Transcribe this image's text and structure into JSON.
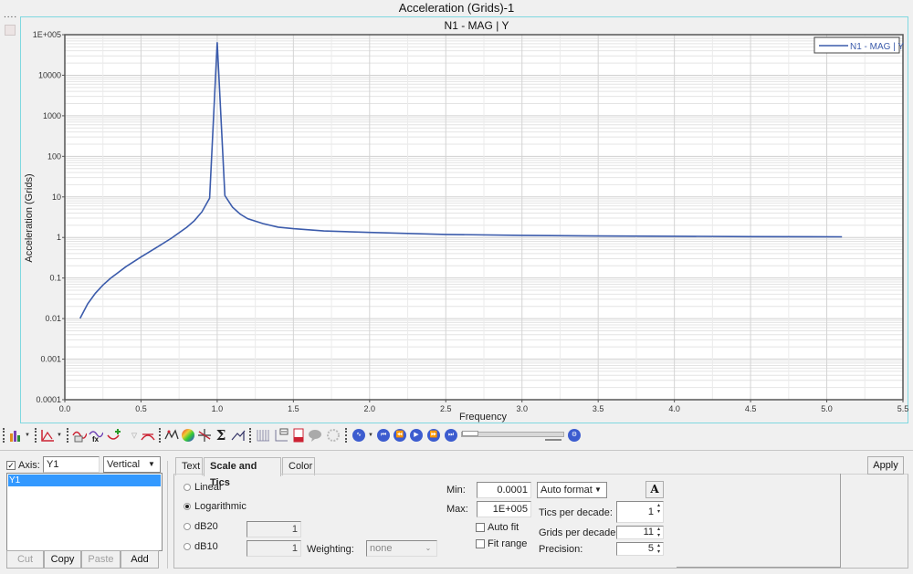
{
  "window": {
    "title": "Acceleration (Grids)-1"
  },
  "chart_data": {
    "type": "line",
    "title": "N1 - MAG | Y",
    "xlabel": "Frequency",
    "ylabel": "Acceleration (Grids)",
    "xlim": [
      0.0,
      5.5
    ],
    "ylim": [
      0.0001,
      100000
    ],
    "yscale": "log",
    "grid": true,
    "legend_position": "top-right",
    "x_tick_labels": [
      "0.0",
      "0.5",
      "1.0",
      "1.5",
      "2.0",
      "2.5",
      "3.0",
      "3.5",
      "4.0",
      "4.5",
      "5.0",
      "5.5"
    ],
    "y_tick_labels": [
      "0.0001",
      "0.001",
      "0.01",
      "0.1",
      "1",
      "10",
      "100",
      "1000",
      "10000",
      "1E+005"
    ],
    "series": [
      {
        "name": "N1 - MAG | Y",
        "color": "#3b5bab",
        "x": [
          0.1,
          0.15,
          0.2,
          0.25,
          0.3,
          0.4,
          0.5,
          0.6,
          0.7,
          0.8,
          0.85,
          0.9,
          0.95,
          1.0,
          1.05,
          1.1,
          1.15,
          1.2,
          1.3,
          1.4,
          1.5,
          1.7,
          2.0,
          2.5,
          3.0,
          3.5,
          4.0,
          4.5,
          5.1
        ],
        "y": [
          0.0101,
          0.023,
          0.042,
          0.067,
          0.099,
          0.19,
          0.33,
          0.56,
          0.96,
          1.78,
          2.6,
          4.3,
          9.3,
          65000,
          10.8,
          5.6,
          3.8,
          2.9,
          2.2,
          1.8,
          1.65,
          1.45,
          1.33,
          1.19,
          1.13,
          1.09,
          1.07,
          1.05,
          1.04
        ]
      }
    ]
  },
  "toolbar": {
    "icons": [
      "plot-type-icon",
      "axis-icon",
      "curve-edit-icon",
      "curve-math-icon",
      "add-point-icon",
      "filter-icon",
      "remove-curve-icon",
      "peak-icon",
      "color-wheel-icon",
      "crosshair-icon",
      "sigma-icon",
      "derivative-icon",
      "grid-icon",
      "legend-icon",
      "notes-icon",
      "comment-icon",
      "settings-disabled-icon",
      "animation-icon",
      "first-frame-icon",
      "prev-frame-icon",
      "play-icon",
      "next-frame-icon",
      "last-frame-icon",
      "animation-settings-icon"
    ],
    "sigma_glyph": "Σ"
  },
  "axis_panel": {
    "axis_checkbox_label": "Axis:",
    "axis_checked": true,
    "axis_name": "Y1",
    "orientation": "Vertical",
    "list_items": [
      "Y1"
    ],
    "buttons": {
      "cut": "Cut",
      "copy": "Copy",
      "paste": "Paste",
      "add": "Add"
    }
  },
  "tabs": [
    {
      "label": "Text",
      "active": false
    },
    {
      "label": "Scale and Tics",
      "active": true
    },
    {
      "label": "Color",
      "active": false
    }
  ],
  "scale": {
    "options": [
      {
        "label": "Linear",
        "selected": false
      },
      {
        "label": "Logarithmic",
        "selected": true
      },
      {
        "label": "dB20",
        "selected": false,
        "value": "1"
      },
      {
        "label": "dB10",
        "selected": false,
        "value": "1"
      }
    ],
    "weighting_label": "Weighting:",
    "weighting_value": "none",
    "min_label": "Min:",
    "min_value": "0.0001",
    "max_label": "Max:",
    "max_value": "1E+005",
    "format_value": "Auto format",
    "font_button": "A",
    "auto_fit_label": "Auto fit",
    "auto_fit_checked": false,
    "fit_range_label": "Fit range",
    "fit_range_checked": false,
    "tics_per_decade_label": "Tics per decade:",
    "tics_per_decade": "1",
    "grids_per_decade_label": "Grids per decade:",
    "grids_per_decade": "11",
    "precision_label": "Precision:",
    "precision": "5"
  },
  "apply_label": "Apply"
}
